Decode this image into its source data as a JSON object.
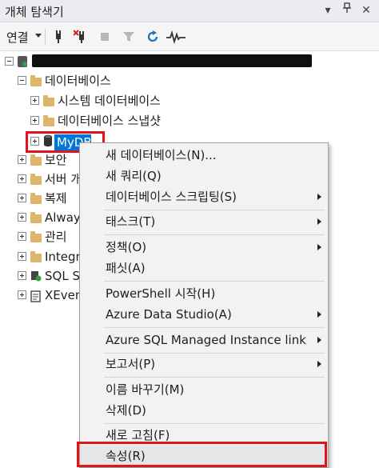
{
  "panel": {
    "title": "개체 탐색기"
  },
  "toolbar": {
    "connect_label": "연결"
  },
  "tree": {
    "databases_label": "데이터베이스",
    "system_db_label": "시스템 데이터베이스",
    "snapshot_label": "데이터베이스 스냅샷",
    "selected_db_label": "MyDB",
    "items": [
      {
        "label": "보안"
      },
      {
        "label": "서버 개"
      },
      {
        "label": "복제"
      },
      {
        "label": "Always"
      },
      {
        "label": "관리"
      },
      {
        "label": "Integra"
      },
      {
        "label": "SQL Se"
      },
      {
        "label": "XEvent"
      }
    ]
  },
  "context_menu": {
    "items": [
      {
        "label": "새 데이터베이스(N)..."
      },
      {
        "label": "새 쿼리(Q)"
      },
      {
        "label": "데이터베이스 스크립팅(S)"
      },
      {
        "label": "태스크(T)"
      },
      {
        "label": "정책(O)"
      },
      {
        "label": "패싯(A)"
      },
      {
        "label": "PowerShell 시작(H)"
      },
      {
        "label": "Azure Data Studio(A)"
      },
      {
        "label": "Azure SQL Managed Instance link"
      },
      {
        "label": "보고서(P)"
      },
      {
        "label": "이름 바꾸기(M)"
      },
      {
        "label": "삭제(D)"
      },
      {
        "label": "새로 고침(F)"
      },
      {
        "label": "속성(R)"
      }
    ]
  },
  "colors": {
    "selection": "#0078d7",
    "highlight_box": "#e3131e",
    "folder": "#dcb66b"
  }
}
